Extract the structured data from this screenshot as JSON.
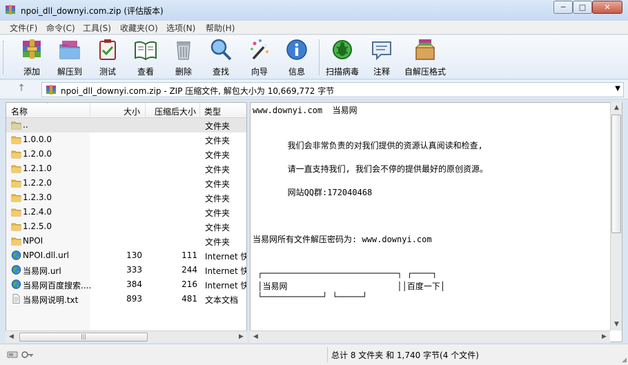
{
  "window": {
    "title": "npoi_dll_downyi.com.zip (评估版本)",
    "controls": {
      "minimize": "─",
      "maximize": "□",
      "close": "✕"
    }
  },
  "menu": [
    "文件(F)",
    "命令(C)",
    "工具(S)",
    "收藏夹(O)",
    "选项(N)",
    "帮助(H)"
  ],
  "toolbar": {
    "add": "添加",
    "extract_to": "解压到",
    "test": "测试",
    "view": "查看",
    "delete": "删除",
    "find": "查找",
    "wizard": "向导",
    "info": "信息",
    "virus_scan": "扫描病毒",
    "comment": "注释",
    "sfx": "自解压格式"
  },
  "address": {
    "up": "↑",
    "text": "npoi_dll_downyi.com.zip - ZIP 压缩文件, 解包大小为 10,669,772 字节",
    "dropdown": "▼"
  },
  "columns": {
    "name": "名称",
    "sort": "˄",
    "size": "大小",
    "packed": "压缩后大小",
    "type": "类型"
  },
  "files": [
    {
      "name": "..",
      "size": "",
      "packed": "",
      "type": "文件夹",
      "icon": "folder-up-icon"
    },
    {
      "name": "1.0.0.0",
      "size": "",
      "packed": "",
      "type": "文件夹",
      "icon": "folder-icon"
    },
    {
      "name": "1.2.0.0",
      "size": "",
      "packed": "",
      "type": "文件夹",
      "icon": "folder-icon"
    },
    {
      "name": "1.2.1.0",
      "size": "",
      "packed": "",
      "type": "文件夹",
      "icon": "folder-icon"
    },
    {
      "name": "1.2.2.0",
      "size": "",
      "packed": "",
      "type": "文件夹",
      "icon": "folder-icon"
    },
    {
      "name": "1.2.3.0",
      "size": "",
      "packed": "",
      "type": "文件夹",
      "icon": "folder-icon"
    },
    {
      "name": "1.2.4.0",
      "size": "",
      "packed": "",
      "type": "文件夹",
      "icon": "folder-icon"
    },
    {
      "name": "1.2.5.0",
      "size": "",
      "packed": "",
      "type": "文件夹",
      "icon": "folder-icon"
    },
    {
      "name": "NPOI",
      "size": "",
      "packed": "",
      "type": "文件夹",
      "icon": "folder-icon"
    },
    {
      "name": "NPOI.dll.url",
      "size": "130",
      "packed": "111",
      "type": "Internet 快",
      "icon": "globe-icon"
    },
    {
      "name": "当易网.url",
      "size": "333",
      "packed": "244",
      "type": "Internet 快",
      "icon": "globe-icon"
    },
    {
      "name": "当易网百度搜索....",
      "size": "384",
      "packed": "216",
      "type": "Internet 快",
      "icon": "globe-icon"
    },
    {
      "name": "当易网说明.txt",
      "size": "893",
      "packed": "481",
      "type": "文本文档",
      "icon": "text-file-icon"
    }
  ],
  "comment_lines": [
    "www.downyi.com  当易网",
    "",
    "",
    "       我们会非常负责的对我们提供的资源认真阅读和检查,",
    "",
    "       请一直支持我们, 我们会不停的提供最好的原创资源。",
    "",
    "       网站QQ群:172040468",
    "",
    "",
    "",
    "当易网所有文件解压密码为: www.downyi.com",
    "",
    "",
    " ┌───────────────────────────┐ ┌────┐",
    " │当易网                      ││百度一下│",
    " └────────────┘ └─────┘",
    "",
    "",
    "--------------------------------------------------"
  ],
  "status": {
    "summary": "总计 8 文件夹 和 1,740 字节(4 个文件)"
  },
  "colors": {
    "chrome": "#dbe6f3",
    "selected_row": "#e6e6e6"
  }
}
